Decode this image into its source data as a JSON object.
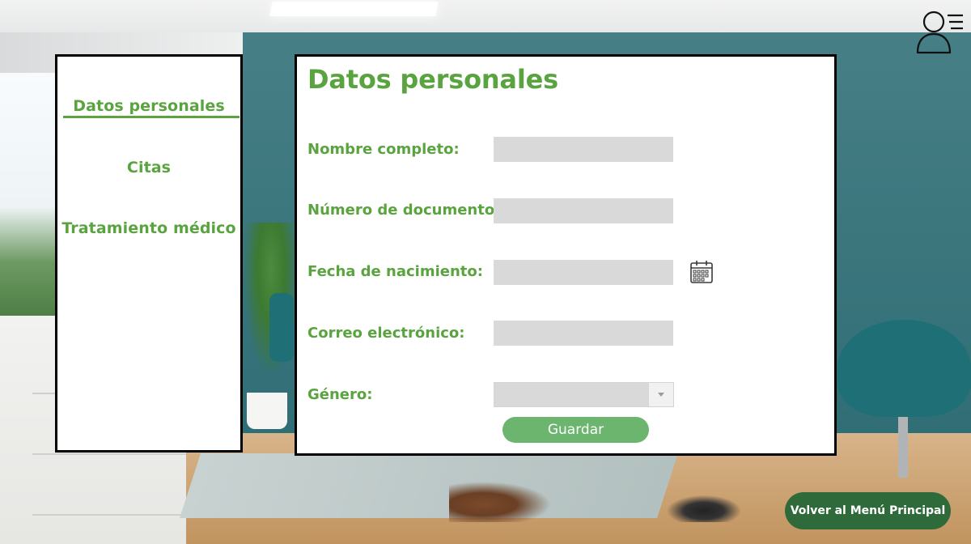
{
  "sidebar": {
    "items": [
      {
        "label": "Datos personales",
        "active": true
      },
      {
        "label": "Citas",
        "active": false
      },
      {
        "label": "Tratamiento médico",
        "active": false
      }
    ]
  },
  "main": {
    "title": "Datos personales",
    "fields": {
      "nombre": {
        "label": "Nombre completo:",
        "value": ""
      },
      "documento": {
        "label": "Número de documento:",
        "value": ""
      },
      "nacimiento": {
        "label": "Fecha de nacimiento:",
        "value": ""
      },
      "correo": {
        "label": "Correo electrónico:",
        "value": ""
      },
      "genero": {
        "label": "Género:",
        "value": ""
      }
    },
    "save_label": "Guardar"
  },
  "footer": {
    "back_label": "Volver al Menú Principal"
  },
  "icons": {
    "user_menu": "user-menu-icon",
    "calendar": "calendar-icon",
    "dropdown": "chevron-down-icon"
  },
  "colors": {
    "accent_green": "#5aa440",
    "button_green": "#6bb56f",
    "back_button_green": "#2f6b3a",
    "field_gray": "#d9d9d9"
  }
}
